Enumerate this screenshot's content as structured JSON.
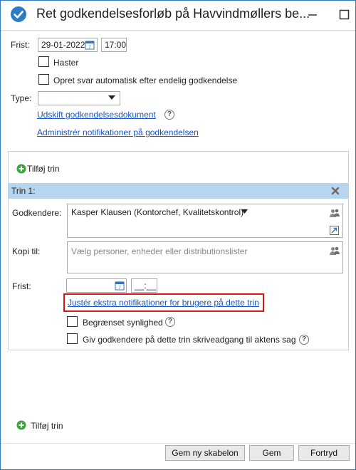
{
  "window": {
    "title": "Ret godkendelsesforløb på Havvindmøllers be...",
    "icon": "check-circle-icon",
    "accent": "#2b7bc5"
  },
  "form": {
    "frist_label": "Frist:",
    "date_value": "29-01-2022",
    "time_value": "17:00",
    "haster_label": "Haster",
    "auto_reply_label": "Opret svar automatisk efter endelig godkendelse",
    "type_label": "Type:",
    "type_value": "",
    "replace_doc_link": "Udskift godkendelsesdokument",
    "manage_notifications_link": "Administrér notifikationer på godkendelsen"
  },
  "steps": {
    "add_step_top": "Tilføj trin",
    "add_step_bottom": "Tilføj trin",
    "step1": {
      "header": "Trin 1:",
      "approvers_label": "Godkendere:",
      "approvers_value": "Kasper Klausen (Kontorchef, Kvalitetskontrol)",
      "copy_label": "Kopi til:",
      "copy_placeholder": "Vælg personer, enheder eller distributionslister",
      "deadline_label": "Frist:",
      "deadline_date": "",
      "deadline_time": "__:__",
      "extra_notifications_link": "Justér ekstra notifikationer for brugere på dette trin",
      "limited_visibility_label": "Begrænset synlighed",
      "write_access_label": "Giv godkendere på dette trin skriveadgang til aktens sag"
    }
  },
  "buttons": {
    "save_template": "Gem ny skabelon",
    "save": "Gem",
    "cancel": "Fortryd"
  },
  "colors": {
    "step_header_bg": "#b7d5ef",
    "link": "#1a56c8",
    "highlight": "#d9131b",
    "add_icon": "#3aa63a"
  }
}
